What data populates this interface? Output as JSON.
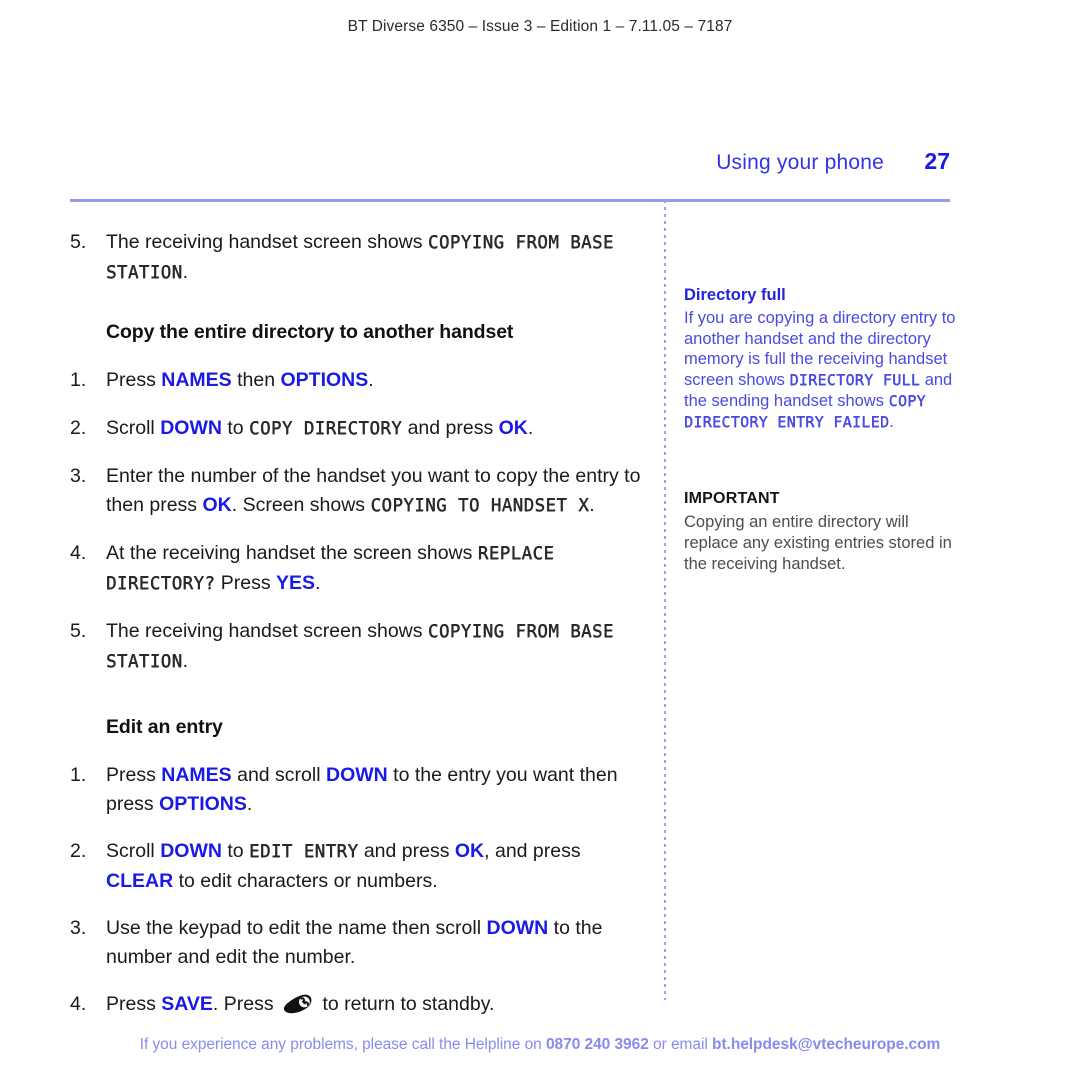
{
  "document": {
    "running_header": "BT Diverse 6350 – Issue 3 – Edition 1 – 7.11.05 – 7187",
    "section_title": "Using your phone",
    "page_number": "27"
  },
  "colors": {
    "key_blue": "#1a1ae6",
    "folio_blue": "#1a1ae0",
    "section_blue": "#3333e6",
    "rule_blue": "#9999ef",
    "sidebar_blue": "#4a4ae2",
    "sidebar_head_blue": "#2424dd",
    "footer_blue": "#8a8aee",
    "body_black": "#1a1a1a"
  },
  "main": {
    "step_top": {
      "num": "5.",
      "p1": "The receiving handset screen shows ",
      "lcd1": "COPYING FROM BASE STATION",
      "p2": "."
    },
    "heading_copy": "Copy the entire directory to another handset",
    "copy_steps": [
      {
        "num": "1.",
        "t1": "Press ",
        "k1": "NAMES",
        "t2": " then ",
        "k2": "OPTIONS",
        "t3": "."
      },
      {
        "num": "2.",
        "t1": "Scroll ",
        "k1": "DOWN",
        "t2": " to ",
        "lcd1": "COPY DIRECTORY",
        "t3": " and press ",
        "k2": "OK",
        "t4": "."
      },
      {
        "num": "3.",
        "t1": "Enter the number of the handset you want to copy the entry to then press ",
        "k1": "OK",
        "t2": ". Screen shows ",
        "lcd1": "COPYING TO HANDSET X",
        "t3": "."
      },
      {
        "num": "4.",
        "t1": "At the receiving handset the screen shows ",
        "lcd1": "REPLACE DIRECTORY?",
        "t2": " Press ",
        "k1": "YES",
        "t3": "."
      },
      {
        "num": "5.",
        "t1": "The receiving handset screen shows ",
        "lcd1": "COPYING FROM BASE  STATION",
        "t2": "."
      }
    ],
    "heading_edit": "Edit an entry",
    "edit_steps": [
      {
        "num": "1.",
        "t1": "Press ",
        "k1": "NAMES",
        "t2": " and scroll ",
        "k2": "DOWN",
        "t3": " to the entry you want then press ",
        "k3": "OPTIONS",
        "t4": "."
      },
      {
        "num": "2.",
        "t1": "Scroll ",
        "k1": "DOWN",
        "t2": " to ",
        "lcd1": "EDIT ENTRY",
        "t3": " and press ",
        "k2": "OK",
        "t4": ", and press ",
        "k3": "CLEAR",
        "t5": " to edit characters or numbers."
      },
      {
        "num": "3.",
        "t1": "Use the keypad to edit the name then scroll ",
        "k1": "DOWN",
        "t2": " to the number and edit the number."
      },
      {
        "num": "4.",
        "t1": "Press ",
        "k1": "SAVE",
        "t2": ". Press ",
        "icon": "handset-key-icon",
        "t3": " to return to standby."
      }
    ]
  },
  "sidebar": {
    "note_directory_full": {
      "heading": "Directory full",
      "t1": "If you are copying a directory entry to another handset and the directory memory is full the receiving handset screen shows ",
      "lcd1": "DIRECTORY FULL",
      "t2": " and the sending handset shows ",
      "lcd2": "COPY DIRECTORY ENTRY FAILED",
      "t3": "."
    },
    "note_important": {
      "heading": "IMPORTANT",
      "body": "Copying an entire directory will replace any existing entries stored in the receiving handset."
    }
  },
  "footer": {
    "t1": "If you experience any problems, please call the Helpline on ",
    "phone": "0870 240 3962",
    "t2": " or email ",
    "email": "bt.helpdesk@vtecheurope.com"
  }
}
